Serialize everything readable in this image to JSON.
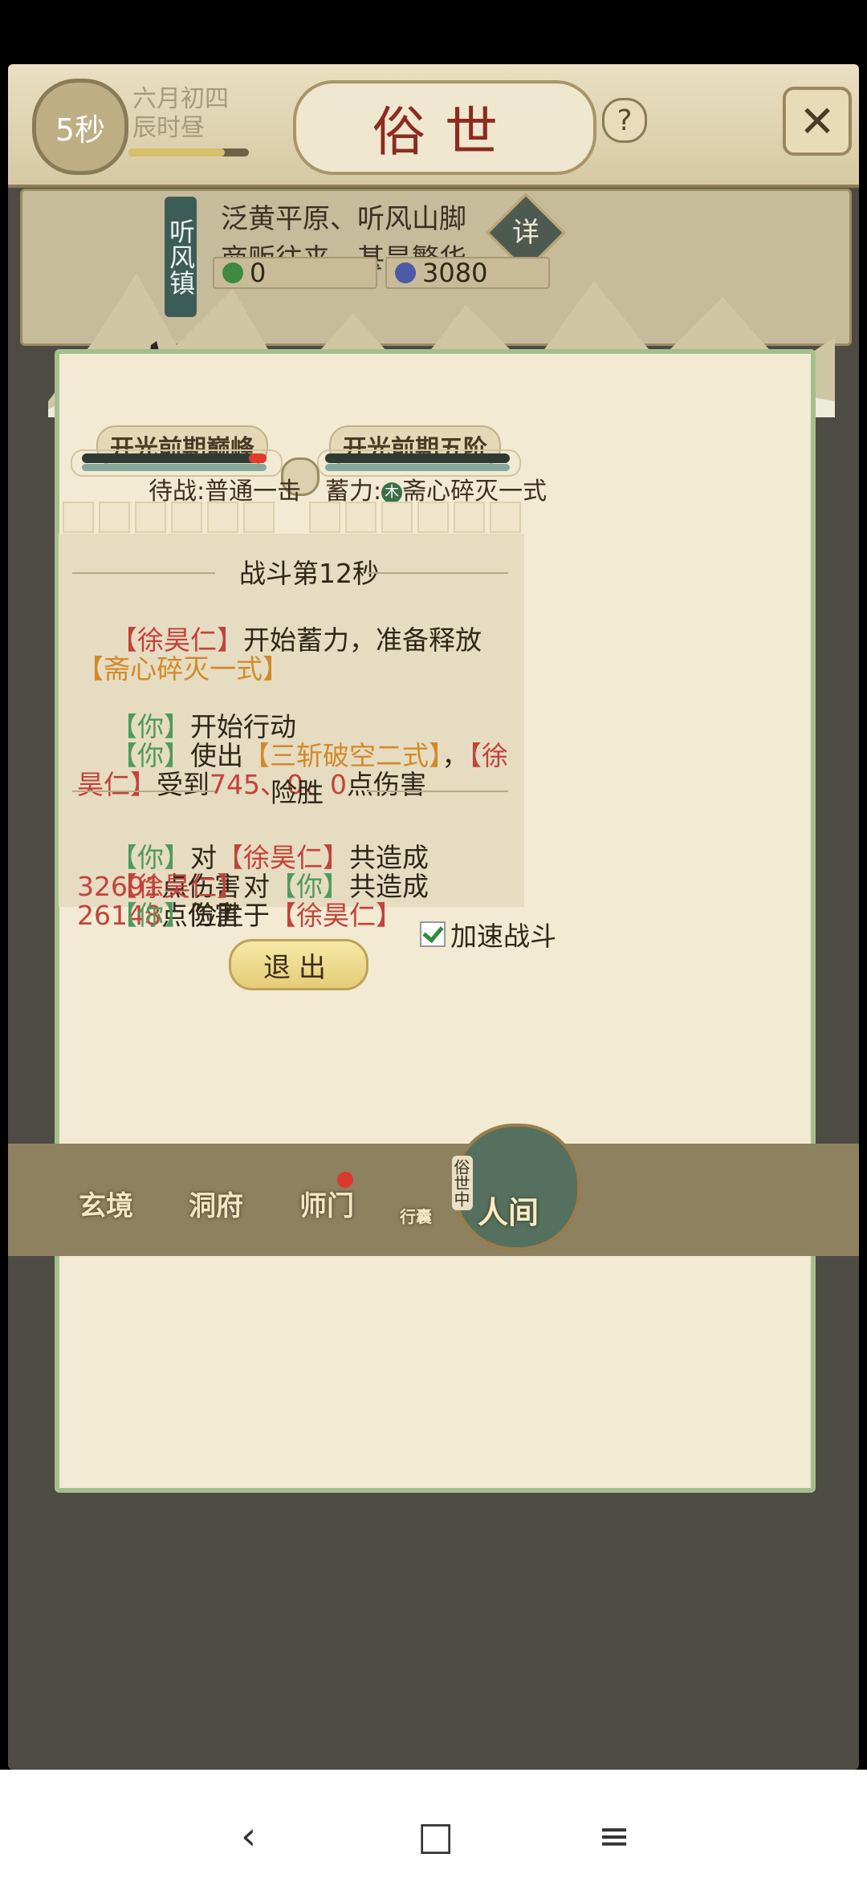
{
  "header": {
    "timer": "5秒",
    "date_line1": "六月初四",
    "date_line2": "辰时昼",
    "title": "俗世",
    "help_icon": "?",
    "close_icon": "✕"
  },
  "location": {
    "town_name": "听风镇",
    "desc_line1": "泛黄平原、听风山脚",
    "desc_line2": "商贩往来，甚是繁华",
    "detail_label": "详",
    "resource1": "0",
    "resource2": "3080",
    "resource1_color": "#3f8a41",
    "resource2_color": "#4b5aa6"
  },
  "battle": {
    "player_realm": "开光前期巅峰",
    "enemy_realm": "开光前期五阶",
    "player_stance": "待战:普通一击",
    "enemy_stance_prefix": "蓄力:",
    "enemy_stance_element": "木",
    "enemy_stance_skill": "斋心碎灭一式",
    "player_hp_fraction": 0.92,
    "section_title": "战斗第12秒",
    "result_title": "险胜",
    "speed_label": "加速战斗",
    "speed_checked": true,
    "exit_label": "退出"
  },
  "log": {
    "line1_name": "【徐昊仁】",
    "line1_text": "开始蓄力，准备释放",
    "line1_skill": "【斋心碎灭一式】",
    "line2_you": "【你】",
    "line2_text": "开始行动",
    "line3_you": "【你】",
    "line3_text": "使出",
    "line3_skill": "【三斩破空二式】",
    "line3_sep": "，",
    "line3_name": "【徐昊仁】",
    "line3_text2": "受到",
    "line3_damage": "745、0、0",
    "line3_text3": "点伤害",
    "sum1_you": "【你】",
    "sum1_to": "对",
    "sum1_name": "【徐昊仁】",
    "sum1_text": "共造成",
    "sum1_damage": "32691",
    "sum1_unit": "点伤害",
    "sum2_name": "【徐昊仁】",
    "sum2_to": "对",
    "sum2_you": "【你】",
    "sum2_text": "共造成",
    "sum2_damage": "26148",
    "sum2_unit": "点伤害",
    "sum3_you": "【你】",
    "sum3_text": "险胜于",
    "sum3_name": "【徐昊仁】"
  },
  "nav": {
    "items": [
      "玄境",
      "洞府",
      "师门",
      "行囊",
      "人间"
    ],
    "side_tag": "俗世中"
  },
  "android": {
    "back": "‹",
    "home": "□",
    "menu": "≡"
  }
}
